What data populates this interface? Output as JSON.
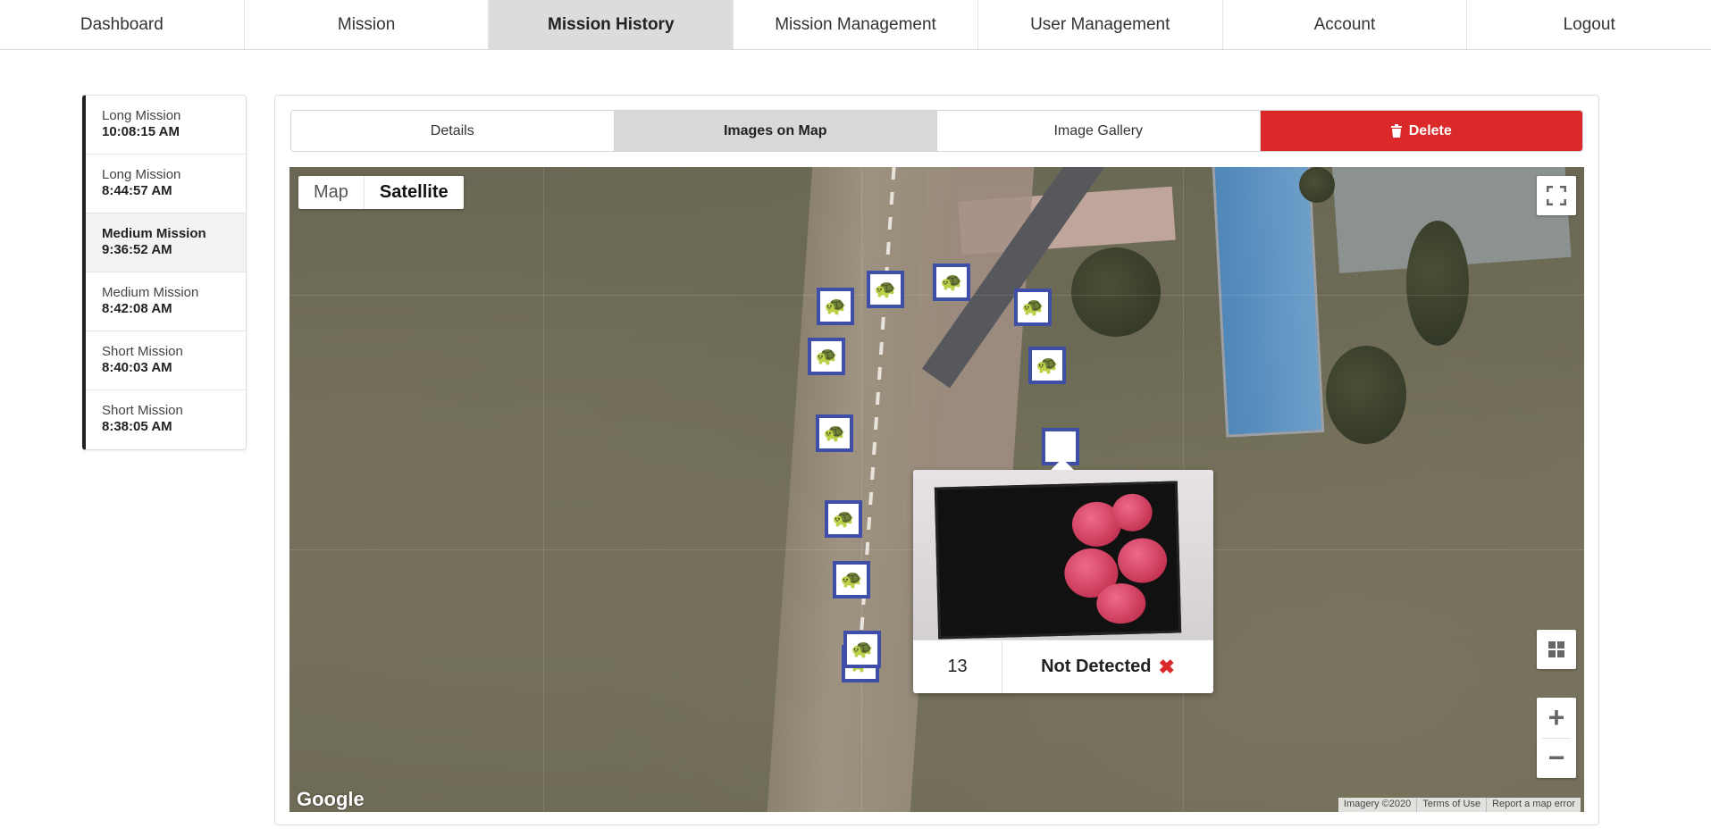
{
  "nav": {
    "items": [
      {
        "label": "Dashboard"
      },
      {
        "label": "Mission"
      },
      {
        "label": "Mission History"
      },
      {
        "label": "Mission Management"
      },
      {
        "label": "User Management"
      },
      {
        "label": "Account"
      },
      {
        "label": "Logout"
      }
    ],
    "active": "Mission History"
  },
  "sidebar": {
    "missions": [
      {
        "name": "Long Mission",
        "time": "10:08:15 AM"
      },
      {
        "name": "Long Mission",
        "time": "8:44:57 AM"
      },
      {
        "name": "Medium Mission",
        "time": "9:36:52 AM"
      },
      {
        "name": "Medium Mission",
        "time": "8:42:08 AM"
      },
      {
        "name": "Short Mission",
        "time": "8:40:03 AM"
      },
      {
        "name": "Short Mission",
        "time": "8:38:05 AM"
      }
    ],
    "active_index": 2
  },
  "tabs": {
    "details": "Details",
    "images_on_map": "Images on Map",
    "image_gallery": "Image Gallery",
    "delete": "Delete",
    "active": "Images on Map"
  },
  "map": {
    "type_map": "Map",
    "type_satellite": "Satellite",
    "active_type": "Satellite",
    "zoom_in": "+",
    "zoom_out": "−",
    "logo": "Google",
    "attribution": {
      "imagery": "Imagery ©2020",
      "terms": "Terms of Use",
      "report": "Report a map error"
    },
    "marker_icon": "turtle-icon",
    "info_window": {
      "image_number": "13",
      "status": "Not Detected",
      "status_icon": "x-mark-icon",
      "status_color": "#db2828"
    }
  },
  "colors": {
    "delete": "#db2828",
    "marker_border": "#3f4ea8",
    "active_tab": "#d9d9d9"
  }
}
